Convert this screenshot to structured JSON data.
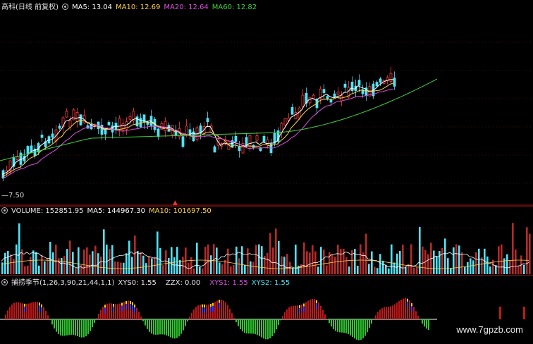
{
  "price_panel": {
    "title": "高科(日线 前复权)",
    "ma5": "MA5: 13.04",
    "ma10": "MA10: 12.69",
    "ma20": "MA20: 12.64",
    "ma60": "MA60: 12.82",
    "low_price_label": "7.50",
    "low_marker": "▲"
  },
  "volume_panel": {
    "volume": "VOLUME: 152851.95",
    "ma5": "MA5: 144967.30",
    "ma10": "MA10: 101697.50"
  },
  "indicator_panel": {
    "name": "捕捞季节(1,26,3,90,21,44,1,1)",
    "xys0": "XYS0: 1.55",
    "zzx": "ZZX: 0.00",
    "xys1": "XYS1: 1.55",
    "xys2": "XYS2: 1.55"
  },
  "watermark": "www.7gpzb.com",
  "colors": {
    "up": "#ff3b3b",
    "down": "#4fe3f5",
    "ma5": "#ffffff",
    "ma10": "#ffd24a",
    "ma20": "#e04ee0",
    "ma60": "#3fd13f",
    "grid": "#8a1414"
  }
}
